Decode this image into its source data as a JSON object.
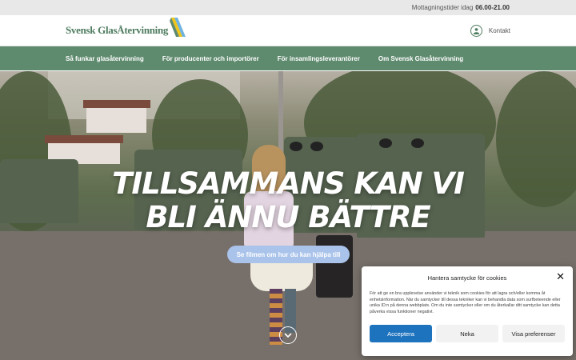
{
  "topbar": {
    "hours_label": "Mottagningstider idag",
    "hours_value": "06.00-21.00"
  },
  "header": {
    "logo_text": "Svensk GlasÅtervinning",
    "contact_label": "Kontakt"
  },
  "nav": {
    "items": [
      {
        "label": "Så funkar glasåtervinning"
      },
      {
        "label": "För producenter och importörer"
      },
      {
        "label": "För insamlingsleverantörer"
      },
      {
        "label": "Om Svensk Glasåtervinning"
      }
    ]
  },
  "hero": {
    "headline_line1": "TILLSAMMANS KAN VI",
    "headline_line2": "BLI ÄNNU BÄTTRE",
    "cta_label": "Se filmen om hur du kan hjälpa till"
  },
  "consent": {
    "title": "Hantera samtycke för cookies",
    "text": "För att ge en bra upplevelse använder vi teknik som cookies för att lagra och/eller komma åt enhetsinformation. När du samtycker till dessa tekniker kan vi behandla data som surfbeteende eller unika ID:n på denna webbplats. Om du inte samtycker eller om du återkallar ditt samtycke kan detta påverka vissa funktioner negativt.",
    "accept_label": "Acceptera",
    "deny_label": "Neka",
    "prefs_label": "Visa preferenser"
  },
  "colors": {
    "brand_green": "#5e8a6e",
    "accept_blue": "#1e73be",
    "cta_blue": "#a9c3ea"
  }
}
